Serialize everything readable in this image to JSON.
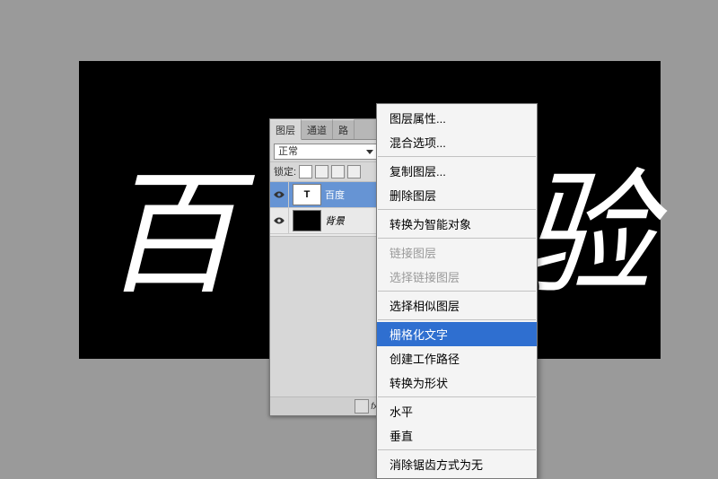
{
  "canvas": {
    "left_text": "百",
    "right_text": "验"
  },
  "panel": {
    "tabs": {
      "layers": "图层",
      "channels": "通道",
      "paths": "路"
    },
    "mode": "正常",
    "lock_label": "锁定:",
    "layers": [
      {
        "name": "百度",
        "thumb": "T",
        "kind": "text",
        "selected": true
      },
      {
        "name": "背景",
        "thumb": "",
        "kind": "bg",
        "selected": false
      }
    ],
    "footer_fx": "fx"
  },
  "menu": {
    "items": [
      {
        "label": "图层属性...",
        "enabled": true,
        "selected": false
      },
      {
        "label": "混合选项...",
        "enabled": true,
        "selected": false
      },
      {
        "sep": true
      },
      {
        "label": "复制图层...",
        "enabled": true,
        "selected": false
      },
      {
        "label": "删除图层",
        "enabled": true,
        "selected": false
      },
      {
        "sep": true
      },
      {
        "label": "转换为智能对象",
        "enabled": true,
        "selected": false
      },
      {
        "sep": true
      },
      {
        "label": "链接图层",
        "enabled": false,
        "selected": false
      },
      {
        "label": "选择链接图层",
        "enabled": false,
        "selected": false
      },
      {
        "sep": true
      },
      {
        "label": "选择相似图层",
        "enabled": true,
        "selected": false
      },
      {
        "sep": true
      },
      {
        "label": "栅格化文字",
        "enabled": true,
        "selected": true
      },
      {
        "label": "创建工作路径",
        "enabled": true,
        "selected": false
      },
      {
        "label": "转换为形状",
        "enabled": true,
        "selected": false
      },
      {
        "sep": true
      },
      {
        "label": "水平",
        "enabled": true,
        "selected": false
      },
      {
        "label": "垂直",
        "enabled": true,
        "selected": false
      },
      {
        "sep": true
      },
      {
        "label": "消除锯齿方式为无",
        "enabled": true,
        "selected": false
      }
    ]
  }
}
